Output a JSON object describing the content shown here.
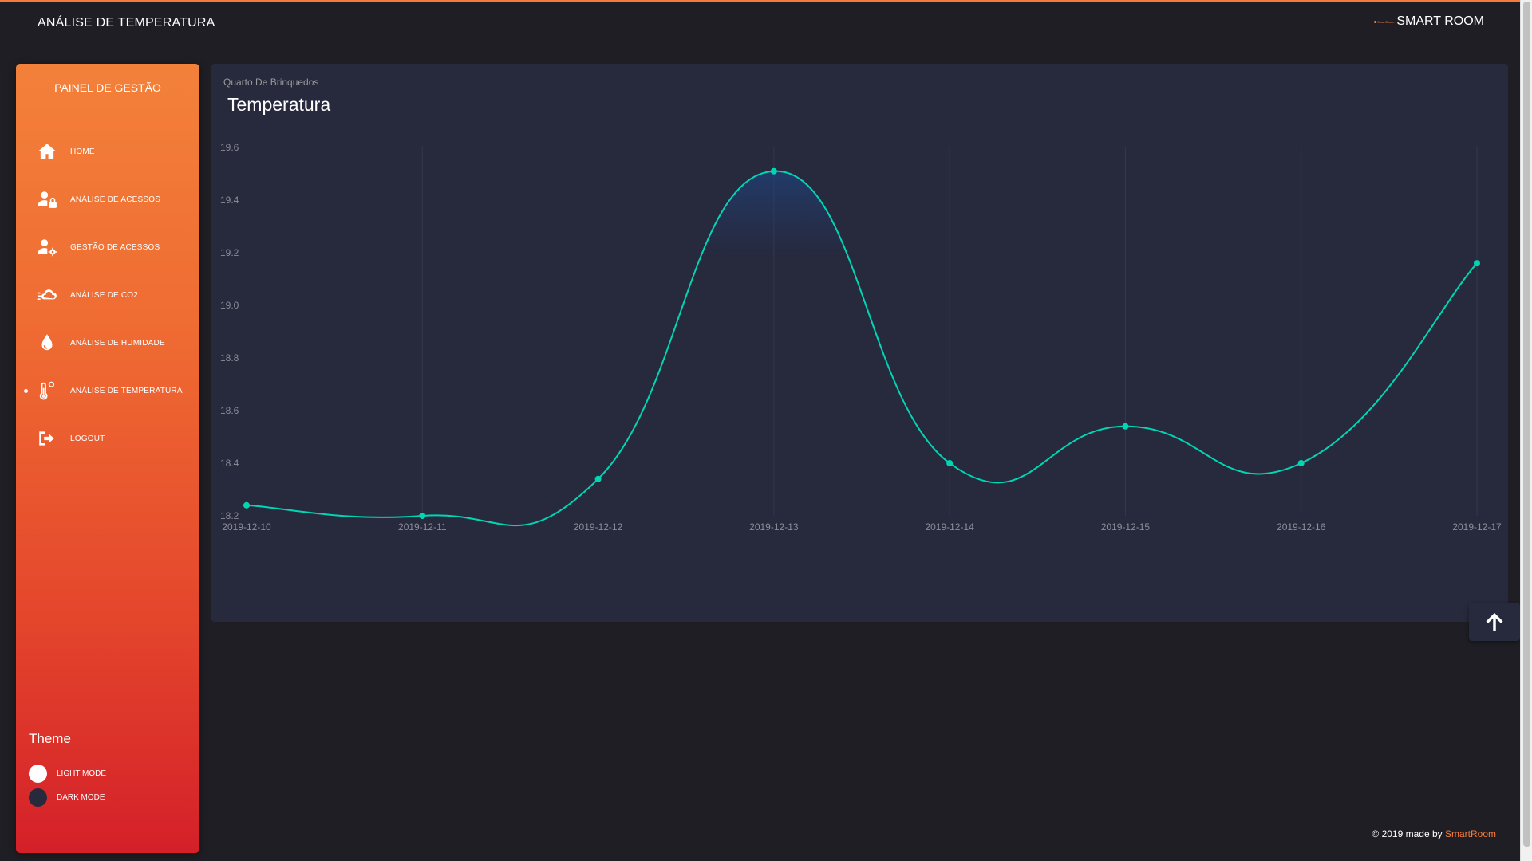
{
  "header": {
    "page_title": "ANÁLISE DE TEMPERATURA",
    "brand_logo_text": "SmartRoom",
    "brand_name": "SMART ROOM",
    "accent_color": "#f47b3d"
  },
  "sidebar": {
    "title": "PAINEL DE GESTÃO",
    "items": [
      {
        "label": "HOME",
        "icon": "home-icon",
        "active": false
      },
      {
        "label": "ANÁLISE DE ACESSOS",
        "icon": "user-lock-icon",
        "active": false
      },
      {
        "label": "GESTÃO DE ACESSOS",
        "icon": "user-cog-icon",
        "active": false
      },
      {
        "label": "ANÁLISE DE CO2",
        "icon": "cloud-wind-icon",
        "active": false
      },
      {
        "label": "ANÁLISE DE HUMIDADE",
        "icon": "droplet-icon",
        "active": false
      },
      {
        "label": "ANÁLISE DE TEMPERATURA",
        "icon": "thermometer-icon",
        "active": true
      },
      {
        "label": "LOGOUT",
        "icon": "logout-icon",
        "active": false
      }
    ],
    "theme": {
      "title": "Theme",
      "light_label": "LIGHT MODE",
      "dark_label": "DARK MODE"
    }
  },
  "card": {
    "subtitle": "Quarto De Brinquedos",
    "title": "Temperatura"
  },
  "chart_data": {
    "type": "line",
    "title": "Temperatura",
    "xlabel": "",
    "ylabel": "",
    "x": [
      "2019-12-10",
      "2019-12-11",
      "2019-12-12",
      "2019-12-13",
      "2019-12-14",
      "2019-12-15",
      "2019-12-16",
      "2019-12-17"
    ],
    "series": [
      {
        "values": [
          18.24,
          18.2,
          18.34,
          19.51,
          18.4,
          18.54,
          18.4,
          19.16
        ],
        "color": "#00d6b4"
      }
    ],
    "ylim": [
      18.2,
      19.6
    ],
    "yticks": [
      "18.2",
      "18.4",
      "18.6",
      "18.8",
      "19.0",
      "19.2",
      "19.4",
      "19.6"
    ],
    "grid": "vertical"
  },
  "footer": {
    "text": "© 2019 made by",
    "link": "SmartRoom"
  },
  "scroll_top": {
    "icon": "arrow-up-icon"
  }
}
